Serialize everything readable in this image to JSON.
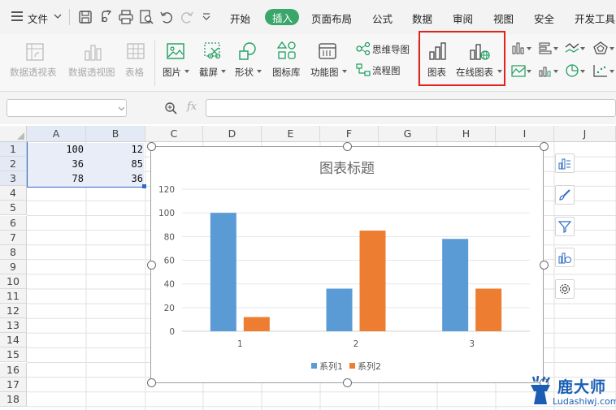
{
  "menu": {
    "file_label": "文件",
    "tabs": [
      "开始",
      "插入",
      "页面布局",
      "公式",
      "数据",
      "审阅",
      "视图",
      "安全",
      "开发工具"
    ],
    "active_tab": "插入"
  },
  "ribbon": {
    "pivot_table": "数据透视表",
    "pivot_chart": "数据透视图",
    "table": "表格",
    "picture": "图片",
    "screenshot": "截屏",
    "shapes": "形状",
    "icon_library": "图标库",
    "function_chart": "功能图",
    "mind_map": "思维导图",
    "flowchart": "流程图",
    "chart": "图表",
    "online_chart": "在线图表"
  },
  "formula_bar": {
    "fx": "fx",
    "name_box": "",
    "formula": ""
  },
  "sheet": {
    "columns": [
      "A",
      "B",
      "C",
      "D",
      "E",
      "F",
      "G",
      "H",
      "I",
      "J"
    ],
    "rows": [
      "1",
      "2",
      "3",
      "4",
      "5",
      "6",
      "7",
      "8",
      "9",
      "10",
      "11",
      "12",
      "13",
      "14",
      "15",
      "16",
      "17",
      "18"
    ],
    "cells": [
      [
        "100",
        "12"
      ],
      [
        "36",
        "85"
      ],
      [
        "78",
        "36"
      ]
    ]
  },
  "chart_data": {
    "type": "bar",
    "title": "图表标题",
    "categories": [
      "1",
      "2",
      "3"
    ],
    "series": [
      {
        "name": "系列1",
        "values": [
          100,
          36,
          78
        ],
        "color": "#5b9bd5"
      },
      {
        "name": "系列2",
        "values": [
          12,
          85,
          36
        ],
        "color": "#ed7d31"
      }
    ],
    "ylim": [
      0,
      120
    ],
    "yticks": [
      "0",
      "20",
      "40",
      "60",
      "80",
      "100",
      "120"
    ],
    "grid": true,
    "legend": "bottom"
  },
  "watermark": {
    "name": "鹿大师",
    "url": "Ludashiwj.com"
  }
}
